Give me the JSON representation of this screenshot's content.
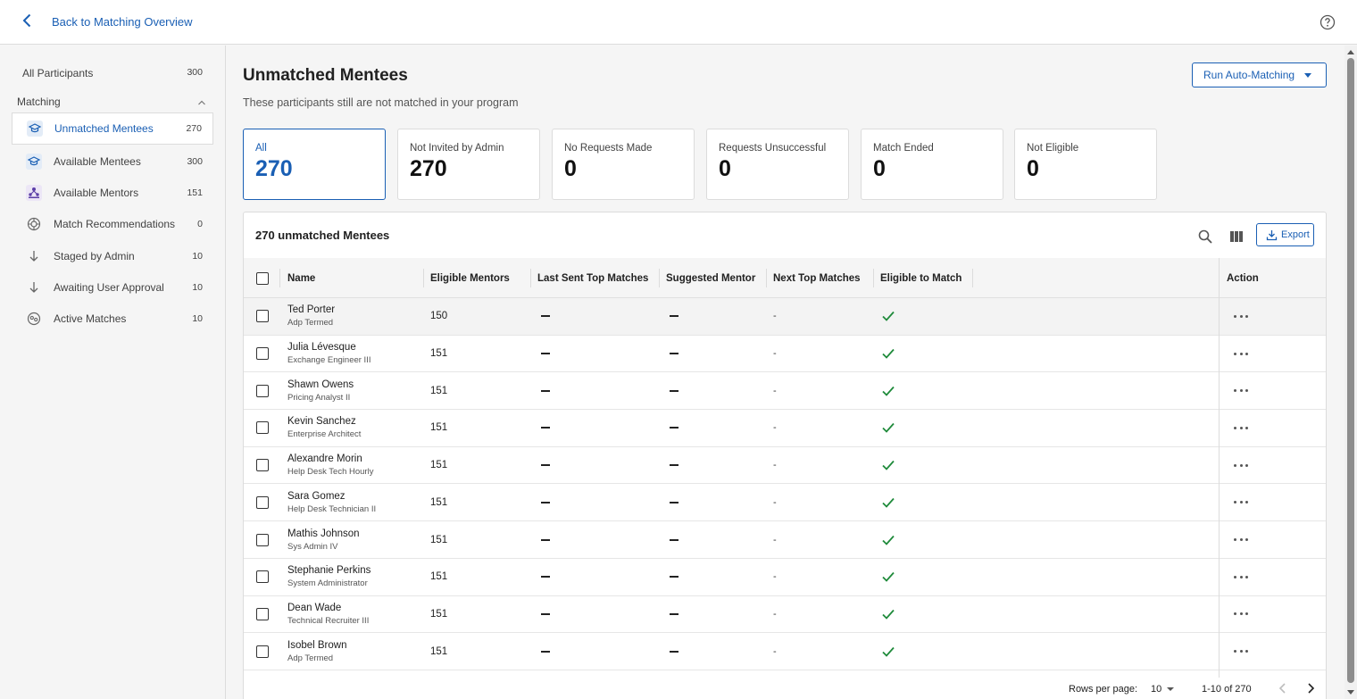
{
  "topbar": {
    "back_label": "Back to Matching Overview"
  },
  "sidebar": {
    "all_label": "All Participants",
    "all_count": "300",
    "section_label": "Matching",
    "items": [
      {
        "label": "Unmatched Mentees",
        "count": "270",
        "icon": "graduation-cap-icon"
      },
      {
        "label": "Available Mentees",
        "count": "300",
        "icon": "graduation-cap-icon"
      },
      {
        "label": "Available Mentors",
        "count": "151",
        "icon": "people-icon"
      },
      {
        "label": "Match Recommendations",
        "count": "0",
        "icon": "target-icon"
      },
      {
        "label": "Staged by Admin",
        "count": "10",
        "icon": "arrow-down-icon"
      },
      {
        "label": "Awaiting User Approval",
        "count": "10",
        "icon": "arrow-down-icon"
      },
      {
        "label": "Active Matches",
        "count": "10",
        "icon": "match-icon"
      }
    ]
  },
  "main": {
    "title": "Unmatched Mentees",
    "subtitle": "These participants still are not matched in your program",
    "run_button": "Run Auto-Matching",
    "cards": [
      {
        "label": "All",
        "value": "270"
      },
      {
        "label": "Not Invited by Admin",
        "value": "270"
      },
      {
        "label": "No Requests Made",
        "value": "0"
      },
      {
        "label": "Requests Unsuccessful",
        "value": "0"
      },
      {
        "label": "Match Ended",
        "value": "0"
      },
      {
        "label": "Not Eligible",
        "value": "0"
      }
    ],
    "table_title": "270 unmatched Mentees",
    "export_label": "Export",
    "columns": {
      "name": "Name",
      "eligible_mentors": "Eligible Mentors",
      "last_sent": "Last Sent Top Matches",
      "suggested": "Suggested Mentor",
      "next_top": "Next Top Matches",
      "eligible_match": "Eligible to Match",
      "action": "Action"
    },
    "rows": [
      {
        "name": "Ted Porter",
        "title": "Adp Termed",
        "eligible": "150",
        "next": "-"
      },
      {
        "name": "Julia Lévesque",
        "title": "Exchange Engineer III",
        "eligible": "151",
        "next": "-"
      },
      {
        "name": "Shawn Owens",
        "title": "Pricing Analyst II",
        "eligible": "151",
        "next": "-"
      },
      {
        "name": "Kevin Sanchez",
        "title": "Enterprise Architect",
        "eligible": "151",
        "next": "-"
      },
      {
        "name": "Alexandre Morin",
        "title": "Help Desk Tech Hourly",
        "eligible": "151",
        "next": "-"
      },
      {
        "name": "Sara Gomez",
        "title": "Help Desk Technician II",
        "eligible": "151",
        "next": "-"
      },
      {
        "name": "Mathis Johnson",
        "title": "Sys Admin IV",
        "eligible": "151",
        "next": "-"
      },
      {
        "name": "Stephanie Perkins",
        "title": "System Administrator",
        "eligible": "151",
        "next": "-"
      },
      {
        "name": "Dean Wade",
        "title": "Technical Recruiter III",
        "eligible": "151",
        "next": "-"
      },
      {
        "name": "Isobel Brown",
        "title": "Adp Termed",
        "eligible": "151",
        "next": "-"
      }
    ],
    "pagination": {
      "rows_per_page_label": "Rows per page:",
      "rows_per_page": "10",
      "range": "1-10 of 270"
    }
  },
  "colors": {
    "accent": "#1a5fb4",
    "check": "#1e8a3a"
  }
}
